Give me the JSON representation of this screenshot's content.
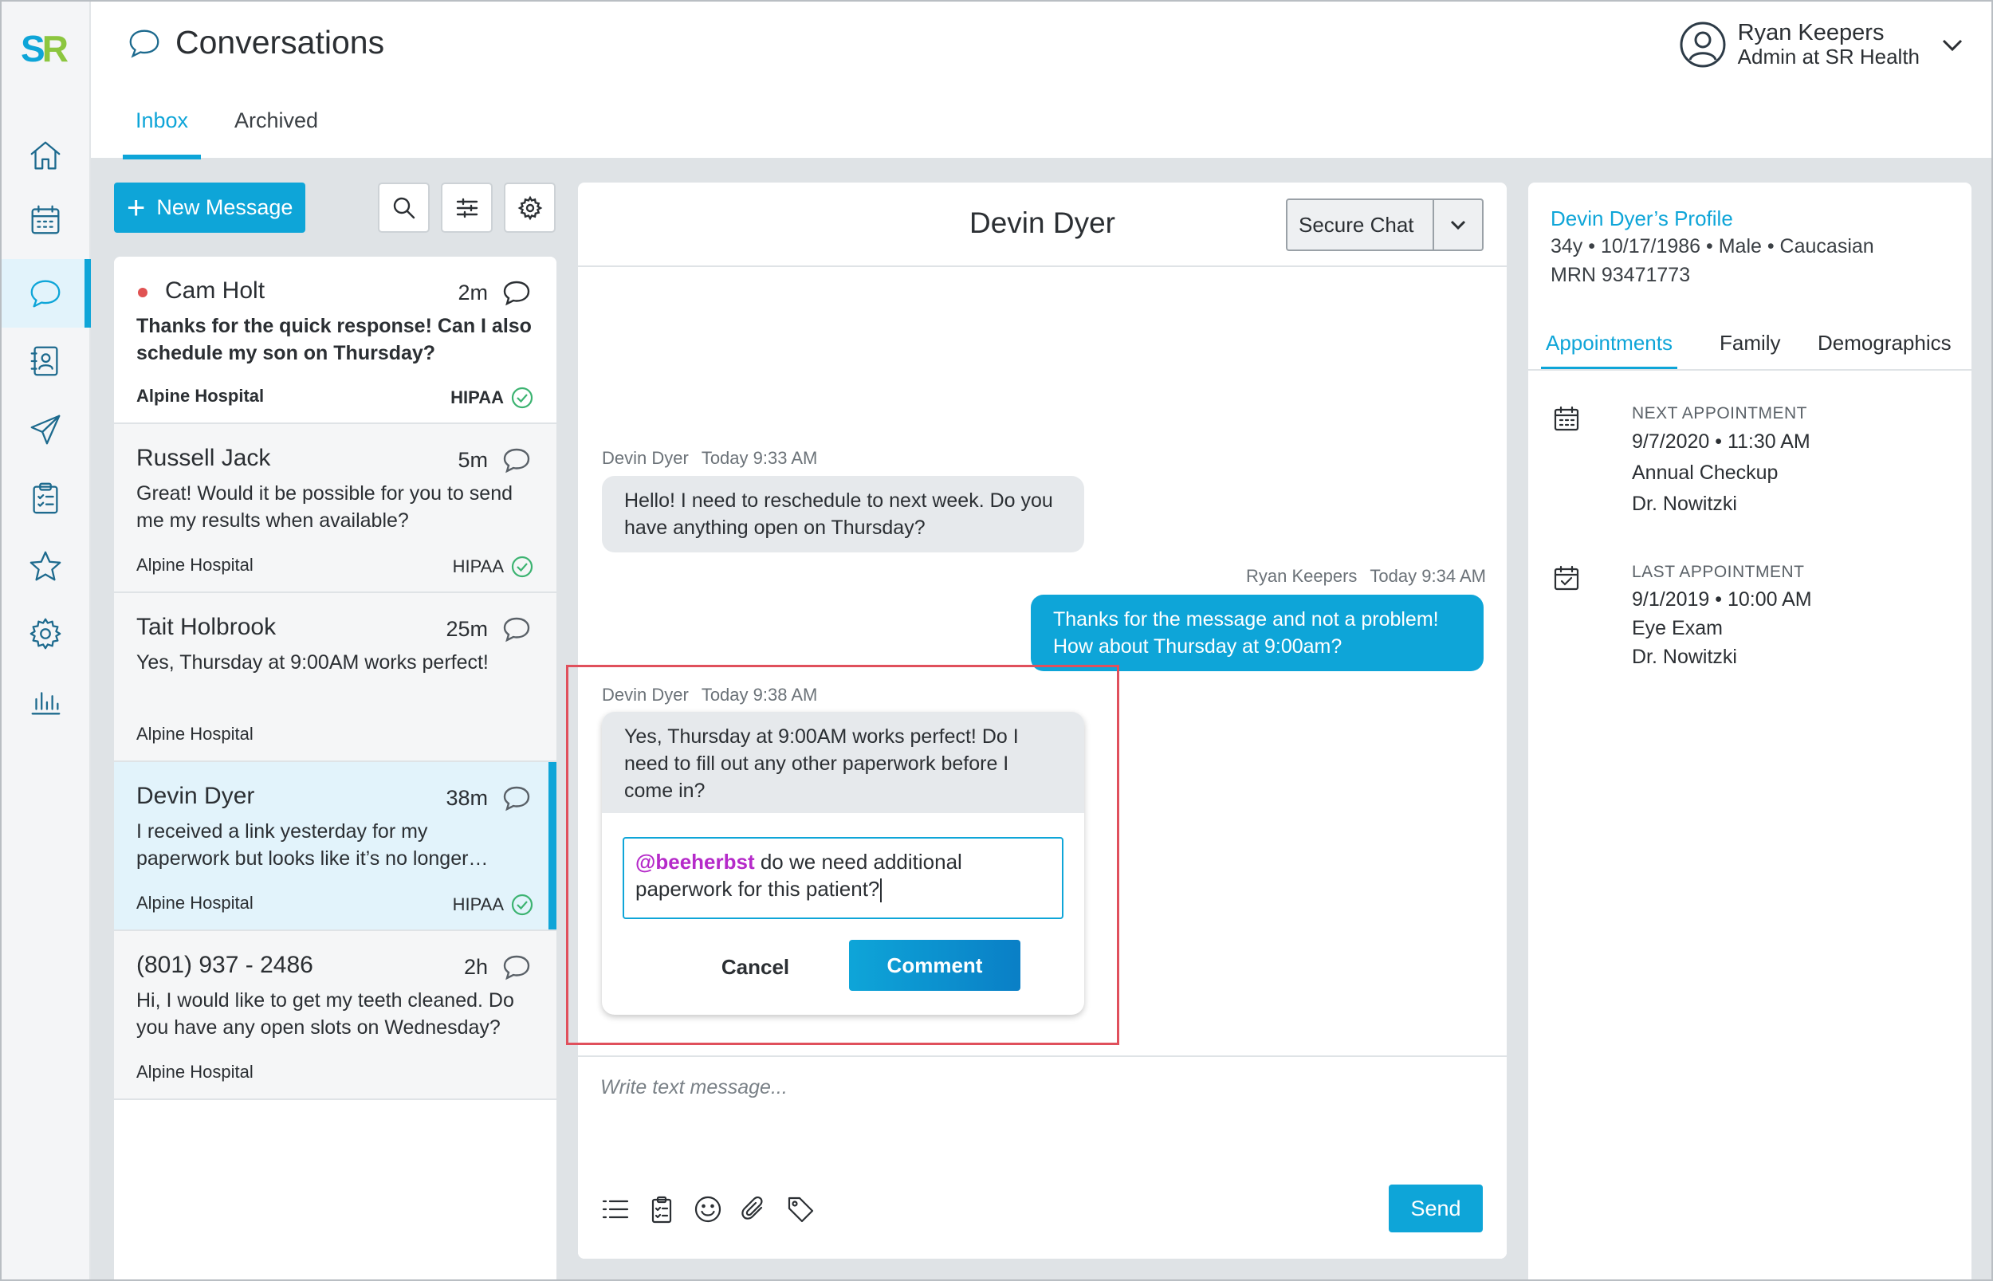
{
  "brand": {
    "logo_s": "S",
    "logo_r": "R"
  },
  "nav": [
    {
      "icon": "home-icon"
    },
    {
      "icon": "calendar-icon"
    },
    {
      "icon": "chat-icon",
      "active": true
    },
    {
      "icon": "contacts-icon"
    },
    {
      "icon": "send-icon"
    },
    {
      "icon": "clipboard-icon"
    },
    {
      "icon": "star-icon"
    },
    {
      "icon": "settings-icon"
    },
    {
      "icon": "analytics-icon"
    }
  ],
  "header": {
    "title": "Conversations",
    "tabs": [
      {
        "label": "Inbox",
        "active": true
      },
      {
        "label": "Archived"
      }
    ],
    "user": {
      "name": "Ryan Keepers",
      "role": "Admin at SR Health"
    }
  },
  "list": {
    "new_message_label": "New Message",
    "conversations": [
      {
        "name": "Cam Holt",
        "time": "2m",
        "preview": "Thanks for the quick response! Can I also schedule my son on Thursday?",
        "source": "Alpine Hospital",
        "hipaa": "HIPAA",
        "unread": true
      },
      {
        "name": "Russell Jack",
        "time": "5m",
        "preview": "Great! Would it be possible for you to send me my results when available?",
        "source": "Alpine Hospital",
        "hipaa": "HIPAA"
      },
      {
        "name": "Tait Holbrook",
        "time": "25m",
        "preview": "Yes, Thursday at 9:00AM works perfect!",
        "source": "Alpine Hospital",
        "hipaa": ""
      },
      {
        "name": "Devin Dyer",
        "time": "38m",
        "preview": "I received a link yesterday for my paperwork but looks like it’s no longer…",
        "source": "Alpine Hospital",
        "hipaa": "HIPAA",
        "selected": true
      },
      {
        "name": "(801) 937 - 2486",
        "time": "2h",
        "preview": "Hi, I would like to get my teeth cleaned. Do you have any open slots on Wednesday?",
        "source": "Alpine Hospital",
        "hipaa": ""
      }
    ]
  },
  "chat": {
    "title": "Devin Dyer",
    "channel": "Secure Chat",
    "messages": [
      {
        "sender": "Devin Dyer",
        "time": "Today 9:33 AM",
        "text": "Hello! I need to reschedule to next week. Do you have anything open on Thursday?"
      },
      {
        "sender": "Ryan Keepers",
        "time": "Today 9:34 AM",
        "text": "Thanks for the message and not a problem! How about Thursday at 9:00am?"
      },
      {
        "sender": "Devin Dyer",
        "time": "Today 9:38 AM",
        "text": "Yes, Thursday at 9:00AM works perfect! Do I need to fill out any other paperwork before I come in?"
      }
    ],
    "comment": {
      "mention": "@beeherbst",
      "text": " do we need additional paperwork for this patient?",
      "cancel_label": "Cancel",
      "submit_label": "Comment"
    },
    "composer": {
      "placeholder": "Write text message...",
      "send_label": "Send"
    }
  },
  "profile": {
    "title": "Devin Dyer’s Profile",
    "demographics_line": "34y • 10/17/1986 • Male • Caucasian",
    "mrn": "MRN 93471773",
    "tabs": [
      {
        "label": "Appointments",
        "active": true
      },
      {
        "label": "Family"
      },
      {
        "label": "Demographics"
      }
    ],
    "next": {
      "label": "NEXT APPOINTMENT",
      "datetime": "9/7/2020 • 11:30 AM",
      "type": "Annual Checkup",
      "doctor": "Dr. Nowitzki"
    },
    "last": {
      "label": "LAST APPOINTMENT",
      "datetime": "9/1/2019 • 10:00 AM",
      "type": "Eye Exam",
      "doctor": "Dr. Nowitzki"
    }
  },
  "colors": {
    "accent": "#0ea5d8",
    "brand_green": "#8cc63f",
    "mention": "#b52ac9",
    "unread": "#e05252",
    "hipaa_ok": "#3cb371",
    "highlight": "#e0505c"
  }
}
